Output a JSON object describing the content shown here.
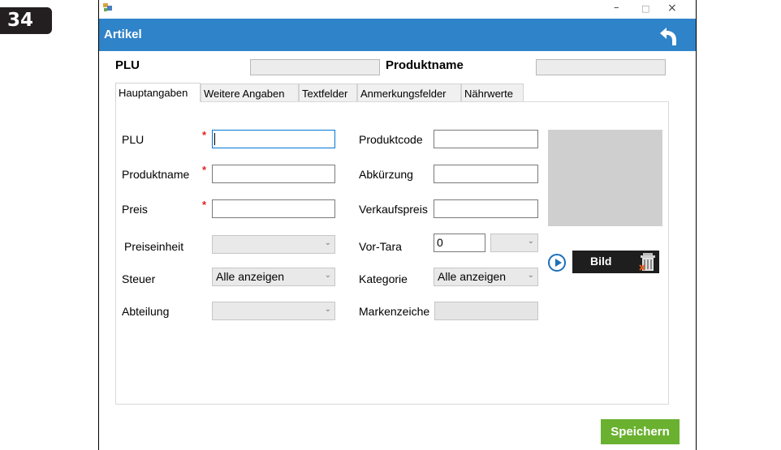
{
  "page_number": "34",
  "window": {
    "minimize": "–",
    "maximize": "□",
    "close": "×"
  },
  "header": {
    "title": "Artikel"
  },
  "top": {
    "plu_label": "PLU",
    "produktname_label": "Produktname"
  },
  "tabs": [
    {
      "label": "Hauptangaben"
    },
    {
      "label": "Weitere Angaben"
    },
    {
      "label": "Textfelder"
    },
    {
      "label": "Anmerkungsfelder"
    },
    {
      "label": "Nährwerte"
    }
  ],
  "form": {
    "plu_label": "PLU",
    "produktname_label": "Produktname",
    "preis_label": "Preis",
    "preiseinheit_label": "Preiseinheit",
    "steuer_label": "Steuer",
    "steuer_value": "Alle anzeigen",
    "abteilung_label": "Abteilung",
    "produktcode_label": "Produktcode",
    "abkuerzung_label": "Abkürzung",
    "verkaufspreis_label": "Verkaufspreis",
    "vortara_label": "Vor-Tara",
    "vortara_value": "0",
    "kategorie_label": "Kategorie",
    "kategorie_value": "Alle anzeigen",
    "markenzeichen_label": "Markenzeiche",
    "required_mark": "*",
    "chevron": "⌄"
  },
  "image": {
    "bild_label": "Bild"
  },
  "footer": {
    "save_label": "Speichern"
  },
  "colors": {
    "header": "#2f83c8",
    "save": "#6ab130",
    "required": "#e02020"
  }
}
